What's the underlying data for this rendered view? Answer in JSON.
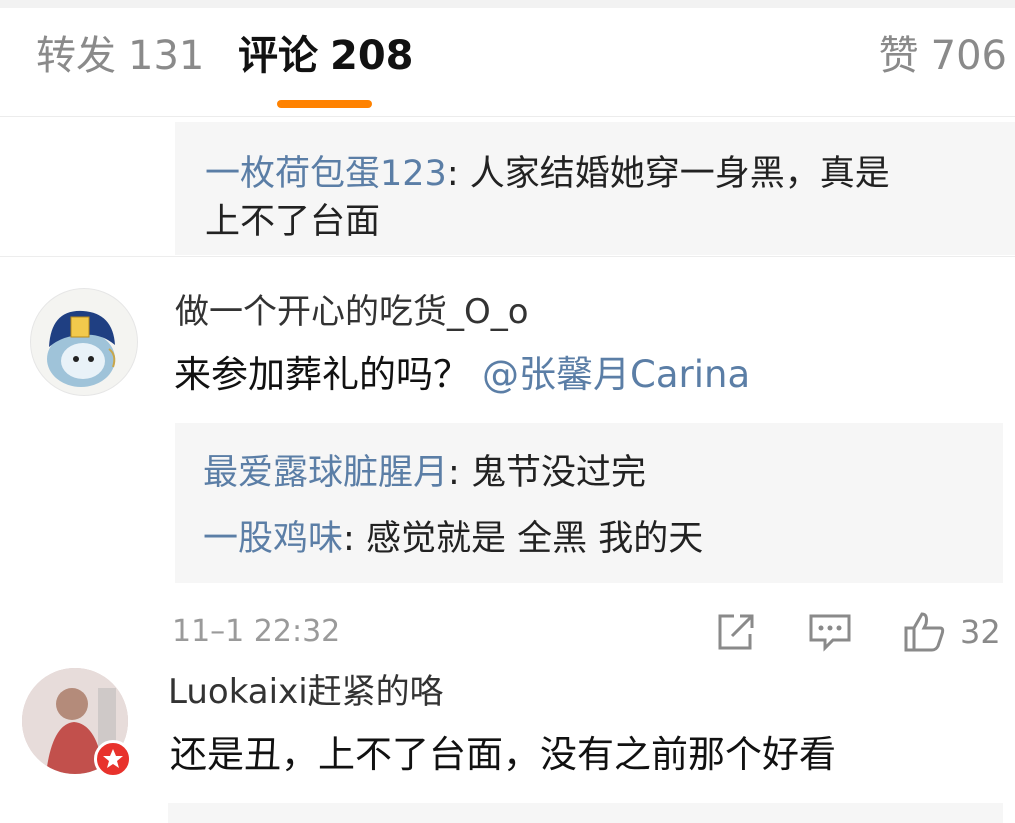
{
  "tabs": {
    "repost": {
      "label": "转发",
      "count": "131"
    },
    "comments": {
      "label": "评论",
      "count": "208"
    },
    "likes": {
      "label": "赞",
      "count": "706"
    },
    "accent_color": "#ff8200"
  },
  "thread_top": {
    "replies": [
      {
        "user": "一枚荷包蛋123",
        "sep": ": ",
        "text_line1": "人家结婚她穿一身黑，真是",
        "text_line2": "上不了台面"
      }
    ]
  },
  "comments": [
    {
      "username": "做一个开心的吃货_O_o",
      "text": "来参加葬礼的吗？",
      "mention": "@张馨月Carina",
      "replies": [
        {
          "user": "最爱露球脏腥月",
          "sep": ": ",
          "text": "鬼节没过完"
        },
        {
          "user": "一股鸡味",
          "sep": ": ",
          "text": "感觉就是 全黑 我的天"
        }
      ],
      "time": "11–1 22:32",
      "like_count": "32",
      "icons": [
        "share-icon",
        "comment-icon",
        "like-icon"
      ]
    },
    {
      "username": "Luokaixi赶紧的咯",
      "text": "还是丑，上不了台面，没有之前那个好看",
      "badge": "verified-badge-icon"
    }
  ],
  "colors": {
    "link": "#5b7ea6",
    "reply_bg": "#f6f6f6",
    "badge": "#e8322c"
  }
}
